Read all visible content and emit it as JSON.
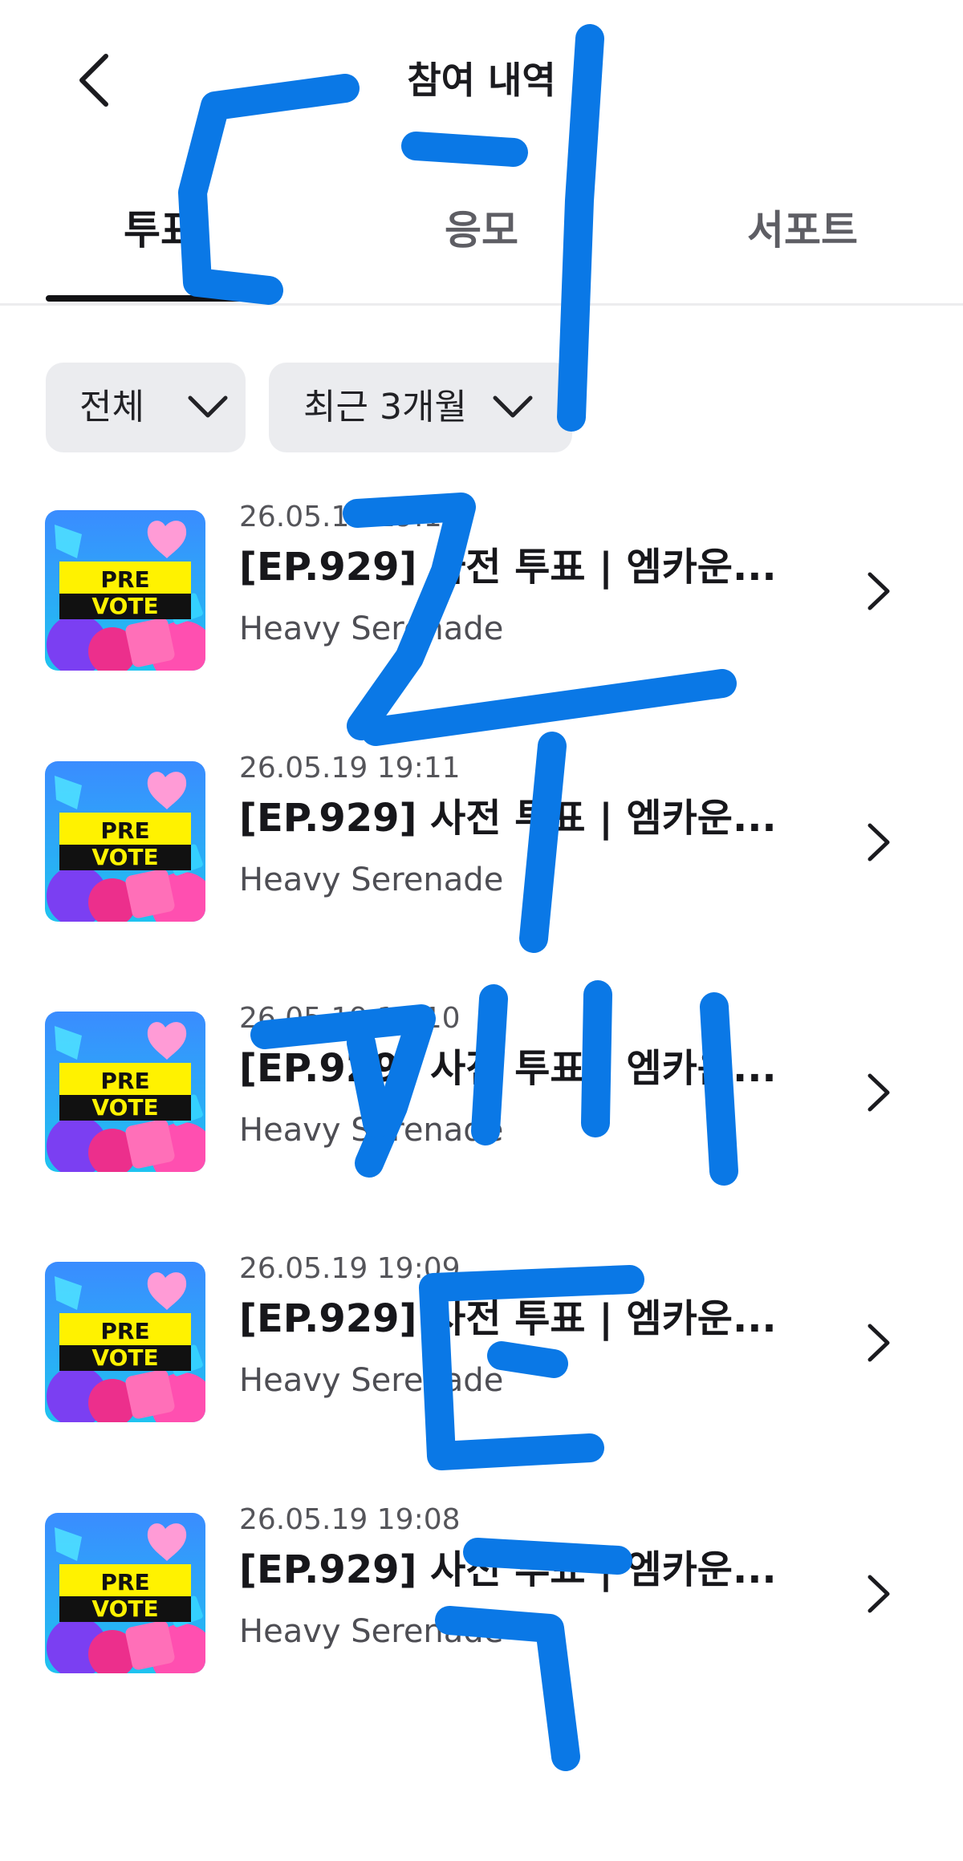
{
  "header": {
    "title": "참여 내역",
    "back_icon": "chevron-left-icon"
  },
  "tabs": [
    {
      "label": "투표",
      "active": true
    },
    {
      "label": "응모",
      "active": false
    },
    {
      "label": "서포트",
      "active": false
    }
  ],
  "filters": {
    "category": {
      "label": "전체",
      "icon": "chevron-down-icon"
    },
    "period": {
      "label": "최근 3개월",
      "icon": "chevron-down-icon"
    }
  },
  "thumbnail_text": {
    "line1": "PRE",
    "line2": "VOTE"
  },
  "items": [
    {
      "date": "26.05.19 19:12",
      "title": "[EP.929] 사전 투표 | 엠카운...",
      "subtitle": "Heavy Serenade"
    },
    {
      "date": "26.05.19 19:11",
      "title": "[EP.929] 사전 투표 | 엠카운...",
      "subtitle": "Heavy Serenade"
    },
    {
      "date": "26.05.19 19:10",
      "title": "[EP.929] 사전 투표 | 엠카운...",
      "subtitle": "Heavy Serenade"
    },
    {
      "date": "26.05.19 19:09",
      "title": "[EP.929] 사전 투표 | 엠카운...",
      "subtitle": "Heavy Serenade"
    },
    {
      "date": "26.05.19 19:08",
      "title": "[EP.929] 사전 투표 | 엠카운...",
      "subtitle": "Heavy Serenade"
    }
  ],
  "colors": {
    "overlay_stroke": "#0a78e6",
    "thumb_yellow": "#fff200",
    "thumb_cyan": "#1fc3f0",
    "thumb_magenta": "#ec2f8c"
  }
}
